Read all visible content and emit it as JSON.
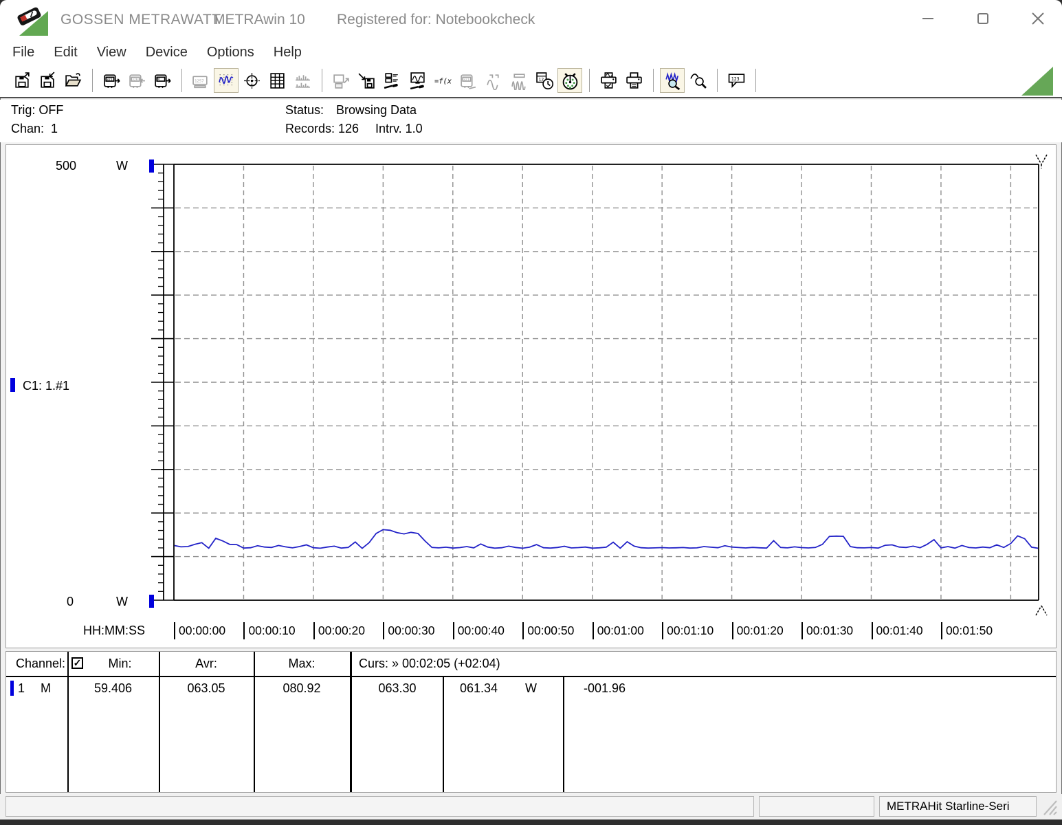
{
  "titlebar": {
    "brand": "GOSSEN METRAWATT",
    "app": "METRAwin 10",
    "registered": "Registered for: Notebookcheck"
  },
  "menu": {
    "items": [
      "File",
      "Edit",
      "View",
      "Device",
      "Options",
      "Help"
    ]
  },
  "toolbar": {
    "buttons": [
      {
        "id": "save-export",
        "icon": "save-export-icon",
        "disabled": false,
        "selected": false
      },
      {
        "id": "save-as",
        "icon": "save-as-icon",
        "disabled": false,
        "selected": false
      },
      {
        "id": "open-file",
        "icon": "open-folder-icon",
        "disabled": false,
        "selected": false
      },
      {
        "sep": true
      },
      {
        "id": "device-read",
        "icon": "device-read-icon",
        "disabled": false,
        "selected": false
      },
      {
        "id": "device-write",
        "icon": "device-write-icon",
        "disabled": true,
        "selected": false
      },
      {
        "id": "memory-read",
        "icon": "memory-read-icon",
        "disabled": false,
        "selected": false
      },
      {
        "sep": true
      },
      {
        "id": "numeric-display",
        "icon": "numeric-display-icon",
        "disabled": true,
        "selected": false
      },
      {
        "id": "line-chart",
        "icon": "line-chart-icon",
        "disabled": false,
        "selected": true
      },
      {
        "id": "xy-chart",
        "icon": "xy-chart-icon",
        "disabled": false,
        "selected": false
      },
      {
        "id": "data-table",
        "icon": "data-table-icon",
        "disabled": false,
        "selected": false
      },
      {
        "id": "histogram",
        "icon": "histogram-icon",
        "disabled": true,
        "selected": false
      },
      {
        "sep": true
      },
      {
        "id": "export-data",
        "icon": "export-data-icon",
        "disabled": true,
        "selected": false
      },
      {
        "id": "import-data",
        "icon": "import-data-icon",
        "disabled": false,
        "selected": false
      },
      {
        "id": "channel-setup",
        "icon": "channel-setup-icon",
        "disabled": false,
        "selected": false
      },
      {
        "id": "display-setup",
        "icon": "display-setup-icon",
        "disabled": false,
        "selected": false
      },
      {
        "id": "formula",
        "icon": "formula-icon",
        "disabled": false,
        "selected": false
      },
      {
        "id": "device-settings",
        "icon": "device-settings-icon",
        "disabled": true,
        "selected": false
      },
      {
        "id": "trigger-single",
        "icon": "trigger-single-icon",
        "disabled": true,
        "selected": false
      },
      {
        "id": "trigger-multi",
        "icon": "trigger-multi-icon",
        "disabled": true,
        "selected": false
      },
      {
        "id": "time-setup",
        "icon": "time-setup-icon",
        "disabled": false,
        "selected": false
      },
      {
        "id": "live-gauge",
        "icon": "live-gauge-icon",
        "disabled": false,
        "selected": true
      },
      {
        "sep": true
      },
      {
        "id": "print-preview",
        "icon": "print-preview-icon",
        "disabled": false,
        "selected": false
      },
      {
        "id": "print",
        "icon": "print-icon",
        "disabled": false,
        "selected": false
      },
      {
        "sep": true
      },
      {
        "id": "zoom-signal",
        "icon": "zoom-signal-icon",
        "disabled": false,
        "selected": true
      },
      {
        "id": "zoom-out",
        "icon": "zoom-out-icon",
        "disabled": false,
        "selected": false
      },
      {
        "sep": true
      },
      {
        "id": "values-tooltip",
        "icon": "values-tooltip-icon",
        "disabled": false,
        "selected": false
      },
      {
        "sep": true
      }
    ]
  },
  "info": {
    "trig": "Trig: OFF",
    "chan": "Chan:  1",
    "status_label": "Status:",
    "status_value": "Browsing Data",
    "records": "Records: 126",
    "interval": "Intrv. 1.0"
  },
  "chart": {
    "y_max_label": "500",
    "y_min_label": "0",
    "unit": "W",
    "channel_legend": "C1: 1.#1",
    "x_axis_name": "HH:MM:SS",
    "colors": {
      "trace": "#2323c8",
      "marker": "#0000dd",
      "grid": "#8f8f8f"
    }
  },
  "chart_data": {
    "type": "line",
    "title": "",
    "xlabel": "HH:MM:SS",
    "ylabel": "W",
    "ylim": [
      0,
      500
    ],
    "grid": true,
    "x_start_s": 0,
    "x_interval_s": 1.0,
    "x_tick_labels": [
      "00:00:00",
      "00:00:10",
      "00:00:20",
      "00:00:30",
      "00:00:40",
      "00:00:50",
      "00:01:00",
      "00:01:10",
      "00:01:20",
      "00:01:30",
      "00:01:40",
      "00:01:50"
    ],
    "cursor_time": "00:02:05",
    "stats": {
      "min": 59.406,
      "avg": 63.05,
      "max": 80.92
    },
    "series": [
      {
        "name": "C1: 1.#1",
        "unit": "W",
        "color": "#2323c8",
        "values": [
          62.8,
          61.2,
          61.5,
          64.0,
          66.0,
          59.6,
          71.0,
          68.0,
          64.0,
          63.8,
          59.8,
          60.2,
          62.5,
          61.0,
          60.5,
          62.8,
          61.2,
          60.0,
          61.5,
          63.5,
          60.2,
          59.6,
          61.0,
          62.0,
          59.8,
          60.5,
          66.8,
          59.5,
          66.0,
          76.5,
          80.9,
          80.2,
          77.5,
          76.0,
          77.8,
          76.5,
          68.0,
          60.5,
          60.0,
          60.8,
          59.8,
          60.3,
          61.5,
          60.0,
          64.5,
          61.0,
          59.7,
          60.2,
          62.0,
          60.5,
          59.6,
          60.8,
          63.8,
          60.2,
          59.8,
          60.5,
          61.8,
          59.9,
          60.3,
          61.0,
          59.7,
          60.1,
          60.8,
          66.5,
          59.6,
          67.0,
          62.0,
          60.2,
          59.8,
          60.0,
          60.3,
          59.9,
          60.1,
          60.4,
          59.8,
          60.0,
          61.5,
          60.8,
          60.2,
          62.5,
          61.0,
          60.4,
          59.9,
          60.6,
          60.1,
          59.8,
          68.3,
          60.5,
          60.0,
          61.2,
          60.3,
          59.9,
          60.5,
          64.0,
          73.2,
          73.5,
          73.3,
          61.5,
          60.2,
          60.0,
          60.4,
          59.8,
          63.0,
          63.5,
          61.0,
          60.5,
          62.0,
          60.2,
          64.0,
          69.5,
          60.0,
          61.5,
          59.7,
          62.8,
          60.4,
          59.9,
          61.0,
          60.2,
          63.5,
          60.5,
          65.0,
          73.8,
          70.5,
          60.8,
          59.5,
          62.0
        ]
      }
    ]
  },
  "table": {
    "header": {
      "channel": "Channel:",
      "min": "Min:",
      "avr": "Avr:",
      "max": "Max:",
      "curs": "Curs: » 00:02:05 (+02:04)",
      "checkbox_checked": "✓"
    },
    "row": {
      "channel_num": "1",
      "flag": "M",
      "min": "59.406",
      "avr": "063.05",
      "max": "080.92",
      "curs_value": "063.30",
      "curs_value2": "061.34",
      "unit": "W",
      "delta": "-001.96"
    }
  },
  "statusbar": {
    "device": "METRAHit Starline-Seri"
  }
}
